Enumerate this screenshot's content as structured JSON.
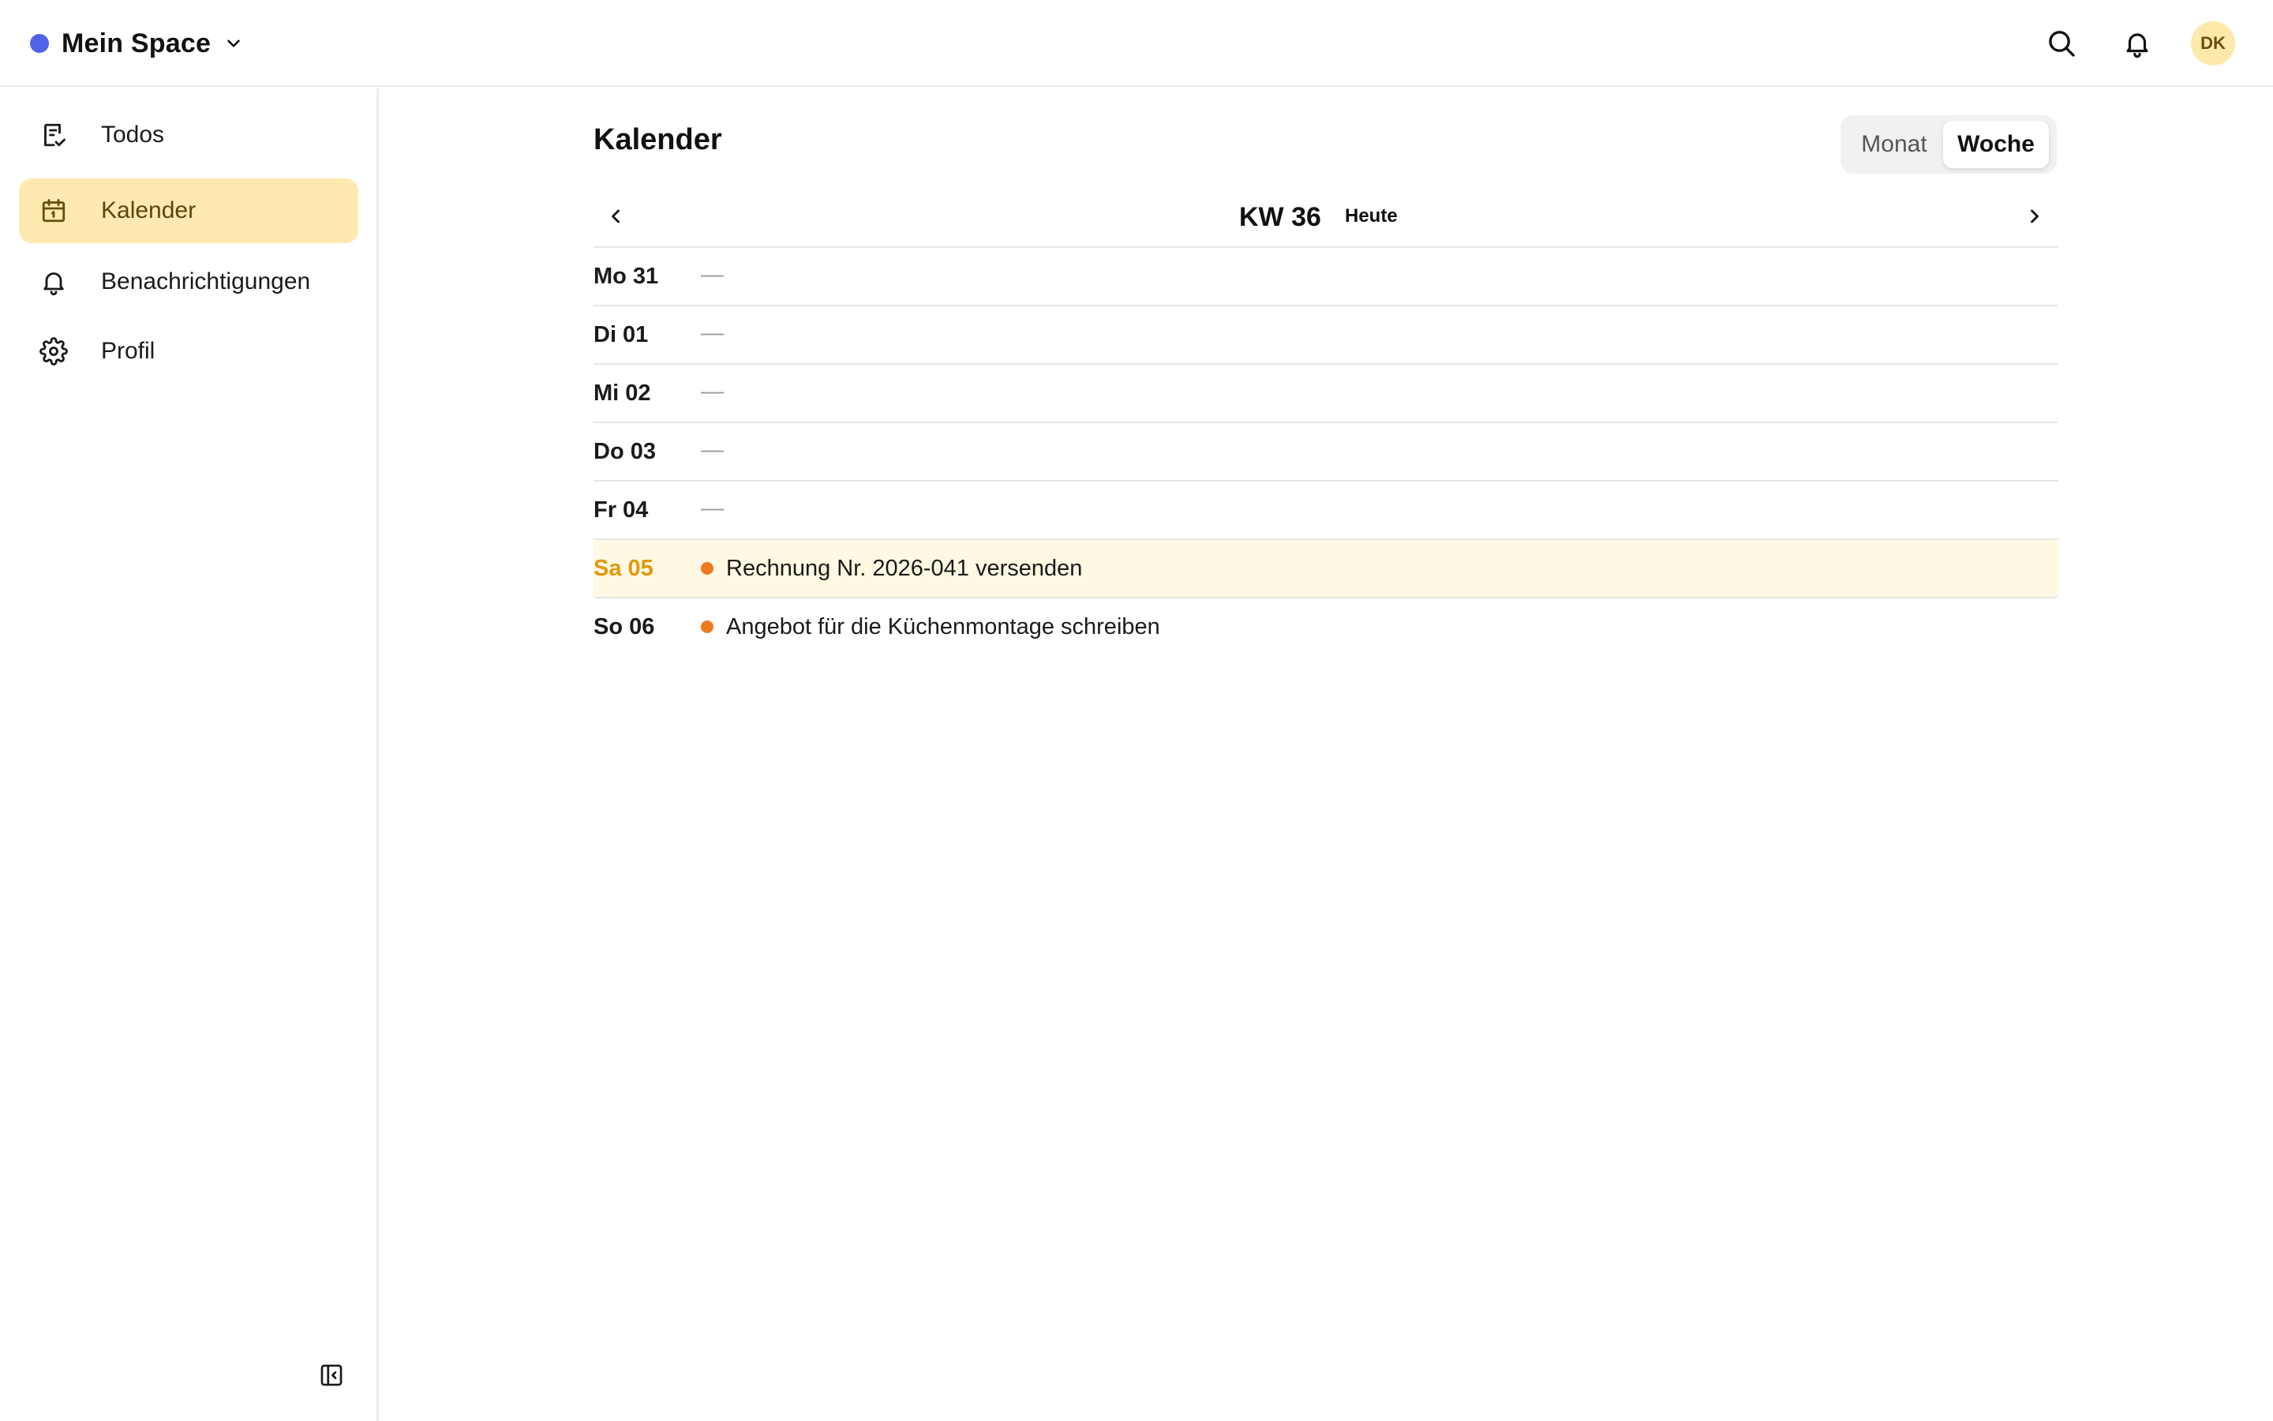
{
  "header": {
    "space_name": "Mein Space",
    "space_color": "#4f63e6",
    "avatar_initials": "DK",
    "icons": [
      "search-icon",
      "bell-icon"
    ]
  },
  "sidebar": {
    "items": [
      {
        "label": "Todos",
        "icon": "todo-list-icon",
        "active": false
      },
      {
        "label": "Kalender",
        "icon": "calendar-icon",
        "active": true
      },
      {
        "label": "Benachrichtigungen",
        "icon": "bell-icon",
        "active": false
      },
      {
        "label": "Profil",
        "icon": "gear-icon",
        "active": false
      }
    ],
    "collapse_icon": "sidebar-collapse-icon"
  },
  "main": {
    "title": "Kalender",
    "view_toggle": {
      "month_label": "Monat",
      "week_label": "Woche",
      "selected": "Woche"
    },
    "week_nav": {
      "week_label": "KW 36",
      "today_label": "Heute"
    },
    "days": [
      {
        "label": "Mo 31",
        "empty": "—"
      },
      {
        "label": "Di 01",
        "empty": "—"
      },
      {
        "label": "Mi 02",
        "empty": "—"
      },
      {
        "label": "Do 03",
        "empty": "—"
      },
      {
        "label": "Fr 04",
        "empty": "—"
      },
      {
        "label": "Sa 05",
        "is_today": true,
        "task": "Rechnung Nr. 2026-041 versenden"
      },
      {
        "label": "So 06",
        "task": "Angebot für die Küchenmontage schreiben"
      }
    ]
  },
  "colors": {
    "accent_active_bg": "#feeab0",
    "today_text": "#e0990c",
    "today_row_bg": "#fff8e2",
    "task_dot": "#ee7a22"
  }
}
